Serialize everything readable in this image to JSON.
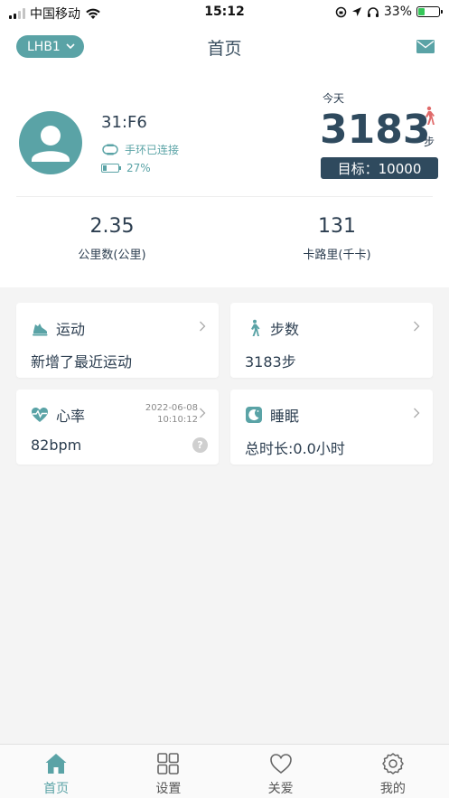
{
  "status_bar": {
    "carrier": "中国移动",
    "time": "15:12",
    "battery_percent": "33%",
    "battery_level": 0.33,
    "battery_color": "#35c759"
  },
  "nav": {
    "device_selector": "LHB1",
    "title": "首页",
    "icons": [
      "chevron-down-icon",
      "mail-icon"
    ]
  },
  "device": {
    "id": "31:F6",
    "connection_status": "手环已连接",
    "battery": "27%",
    "battery_level": 0.27
  },
  "today": {
    "label": "今天",
    "steps": "3183",
    "unit": "步",
    "goal": "目标：10000"
  },
  "stats": [
    {
      "value": "2.35",
      "label": "公里数(公里)"
    },
    {
      "value": "131",
      "label": "卡路里(千卡)"
    }
  ],
  "cards": {
    "exercise": {
      "title": "运动",
      "value": "新增了最近运动",
      "icon": "running-shoe-icon"
    },
    "steps": {
      "title": "步数",
      "value": "3183步",
      "icon": "walking-icon"
    },
    "heart_rate": {
      "title": "心率",
      "value": "82bpm",
      "date": "2022-06-08",
      "time": "10:10:12",
      "icon": "heart-pulse-icon",
      "help": "?"
    },
    "sleep": {
      "title": "睡眠",
      "value": "总时长:0.0小时",
      "icon": "moon-icon"
    }
  },
  "tabs": [
    {
      "label": "首页",
      "icon": "home-icon",
      "active": true
    },
    {
      "label": "设置",
      "icon": "grid-icon",
      "active": false
    },
    {
      "label": "关爱",
      "icon": "heart-icon",
      "active": false
    },
    {
      "label": "我的",
      "icon": "gear-icon",
      "active": false
    }
  ],
  "colors": {
    "accent": "#5aa3a6",
    "dark": "#2f4a5e",
    "walk_icon": "#e06a6a"
  }
}
